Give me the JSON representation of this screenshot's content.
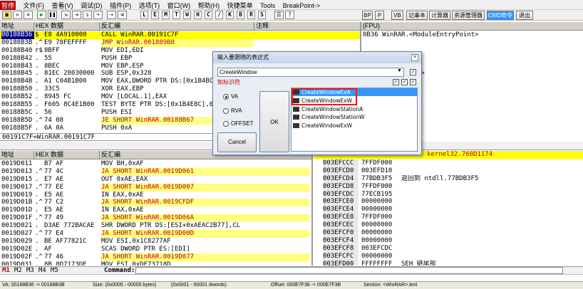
{
  "menubar": {
    "paused": "暂停",
    "items": [
      "文件(F)",
      "查看(V)",
      "调试(D)",
      "插件(P)",
      "选项(T)",
      "窗口(W)",
      "帮助(H)",
      "快捷菜单",
      "Tools",
      "BreakPoint->"
    ]
  },
  "toolbar": {
    "letters": [
      "L",
      "E",
      "M",
      "T",
      "W",
      "H",
      "C",
      "/",
      "K",
      "B",
      "R",
      "S"
    ],
    "plugin_buttons": [
      "BP",
      "P",
      "VB",
      "记事本",
      "计算器",
      "资源管理器",
      "CMD命令",
      "退出"
    ]
  },
  "cpu": {
    "headers": {
      "addr": "地址",
      "hex": "HEX 数据",
      "disasm": "反汇编",
      "comment": "注释"
    },
    "rows": [
      {
        "a": "00188B36",
        "m": "$",
        "h": "E8 4A910000",
        "d": "CALL WinRAR.00191C7F",
        "t": "sel"
      },
      {
        "a": "00188B3B",
        "m": ".^",
        "h": "E9 78FEFFFF",
        "d": "JMP WinRAR.001889B8",
        "t": "jmp"
      },
      {
        "a": "00188B40",
        "m": "r$",
        "h": "8BFF",
        "d": "MOV EDI,EDI",
        "t": ""
      },
      {
        "a": "00188B42",
        "m": ".",
        "h": "55",
        "d": "PUSH EBP",
        "t": ""
      },
      {
        "a": "00188B43",
        "m": ".",
        "h": "8BEC",
        "d": "MOV EBP,ESP",
        "t": ""
      },
      {
        "a": "00188B45",
        "m": ".",
        "h": "81EC 28030000",
        "d": "SUB ESP,0x328",
        "t": ""
      },
      {
        "a": "00188B4B",
        "m": ".",
        "h": "A1 C04B1B00",
        "d": "MOV EAX,DWORD PTR DS:[0x1B4BC0]",
        "t": ""
      },
      {
        "a": "00188B50",
        "m": ".",
        "h": "33C5",
        "d": "XOR EAX,EBP",
        "t": ""
      },
      {
        "a": "00188B52",
        "m": ".",
        "h": "8945 FC",
        "d": "MOV [LOCAL.1],EAX",
        "t": ""
      },
      {
        "a": "00188B55",
        "m": ".",
        "h": "F605 8C4E1B00",
        "d": "TEST BYTE PTR DS:[0x1B4E8C],0",
        "t": ""
      },
      {
        "a": "00188B5C",
        "m": ".",
        "h": "56",
        "d": "PUSH ESI",
        "t": ""
      },
      {
        "a": "00188B5D",
        "m": ".^",
        "h": "74 08",
        "d": "JE SHORT WinRAR.00188B67",
        "t": "jmp"
      },
      {
        "a": "00188B5F",
        "m": ".",
        "h": "6A 0A",
        "d": "PUSH 0xA",
        "t": ""
      }
    ],
    "info": "00191C7F=WinRAR.00191C7F"
  },
  "registers": {
    "header": "(FPU)",
    "lines": [
      "0B36 WinRAR.<ModuleEntryPoint>",
      "",
      "",
      "",
      "",
      "oduleEntryPoint>",
      "FFFFF)",
      "FFFFF)",
      "FFFFF)",
      "000(FFF)"
    ]
  },
  "dump": {
    "headers": {
      "addr": "地址",
      "hex": "HEX 数据",
      "disasm": "反汇编"
    },
    "rows": [
      {
        "a": "0019D011",
        "m": "",
        "h": "B7 AF",
        "d": "MOV BH,0xAF",
        "t": ""
      },
      {
        "a": "0019D013",
        "m": ".^",
        "h": "77 4C",
        "d": "JA SHORT WinRAR.0019D061",
        "t": "jmp"
      },
      {
        "a": "0019D015",
        "m": ".",
        "h": "E7 AE",
        "d": "OUT 0xAE,EAX",
        "t": ""
      },
      {
        "a": "0019D017",
        "m": ".^",
        "h": "77 EE",
        "d": "JA SHORT WinRAR.0019D007",
        "t": "jmp"
      },
      {
        "a": "0019D019",
        "m": ".",
        "h": "E5 AE",
        "d": "IN EAX,0xAE",
        "t": ""
      },
      {
        "a": "0019D01B",
        "m": ".^",
        "h": "77 C2",
        "d": "JA SHORT WinRAR.0019CFDF",
        "t": "jmp"
      },
      {
        "a": "0019D01D",
        "m": ".",
        "h": "E5 AE",
        "d": "IN EAX,0xAE",
        "t": ""
      },
      {
        "a": "0019D01F",
        "m": ".^",
        "h": "77 49",
        "d": "JA SHORT WinRAR.0019D06A",
        "t": "jmp"
      },
      {
        "a": "0019D021",
        "m": ".",
        "h": "D3AE 772BACAE",
        "d": "SHR DWORD PTR DS:[ESI+0xAEAC2B77],CL",
        "t": ""
      },
      {
        "a": "0019D027",
        "m": ".^",
        "h": "77 E4",
        "d": "JA SHORT WinRAR.0019D00D",
        "t": "jmp"
      },
      {
        "a": "0019D029",
        "m": ".",
        "h": "BE AF77821C",
        "d": "MOV ESI,0x1C8277AF",
        "t": ""
      },
      {
        "a": "0019D02E",
        "m": ".",
        "h": "AF",
        "d": "SCAS DWORD PTR ES:[EDI]",
        "t": ""
      },
      {
        "a": "0019D02F",
        "m": ".^",
        "h": "77 46",
        "d": "JA SHORT WinRAR.0019D077",
        "t": "jmp"
      },
      {
        "a": "0019D031",
        "m": ".",
        "h": "8B 8D7173DE",
        "d": "MOV ESI,0xDE73718D",
        "t": ""
      }
    ]
  },
  "stack": {
    "title": "kernel32.760D1174",
    "rows": [
      {
        "a": "003EFCCC",
        "v": "7FFDF000",
        "c": ""
      },
      {
        "a": "003EFCD0",
        "v": "003EFD10",
        "c": ""
      },
      {
        "a": "003EFCD4",
        "v": "77BDB3F5",
        "c": "返回到 ntdll.77BDB3F5"
      },
      {
        "a": "003EFCD8",
        "v": "7FFDF000",
        "c": ""
      },
      {
        "a": "003EFCDC",
        "v": "77ECB195",
        "c": ""
      },
      {
        "a": "003EFCE0",
        "v": "00000000",
        "c": ""
      },
      {
        "a": "003EFCE4",
        "v": "00000000",
        "c": ""
      },
      {
        "a": "003EFCE8",
        "v": "7FFDF000",
        "c": ""
      },
      {
        "a": "003EFCEC",
        "v": "00000000",
        "c": ""
      },
      {
        "a": "003EFCF0",
        "v": "00000000",
        "c": ""
      },
      {
        "a": "003EFCF4",
        "v": "00000000",
        "c": ""
      },
      {
        "a": "003EFCF8",
        "v": "003EFCDC",
        "c": ""
      },
      {
        "a": "003EFCFC",
        "v": "00000000",
        "c": ""
      },
      {
        "a": "003EFD00",
        "v": "FFFFFFFF",
        "c": "SEH 链尾部"
      }
    ]
  },
  "bottom": {
    "tabs": [
      "M1",
      "M2",
      "M3",
      "M4",
      "M5"
    ],
    "command_label": "Command:"
  },
  "status": {
    "left": "VA: 00188B36 -> 00188B3B",
    "size": "Size: (0x0005 - 00005 bytes)",
    "count": "(0x0001 - 00001 dwords)",
    "offset": "Offset: 000E7F36 -> 000E7F3B",
    "section": "Section: <WinRAR>.text"
  },
  "dialog": {
    "title": "输入要跟随的表达式",
    "value": "CreateWindow",
    "hint": "知标识符",
    "va": "VA",
    "rva": "RVA",
    "offset": "OFFSET",
    "ok": "OK",
    "cancel": "Cancel",
    "list": [
      "CreateWindowExA",
      "CreateWindowExW",
      "CreateWindowStationA",
      "CreateWindowStationW",
      "CreateWindowExW"
    ]
  }
}
